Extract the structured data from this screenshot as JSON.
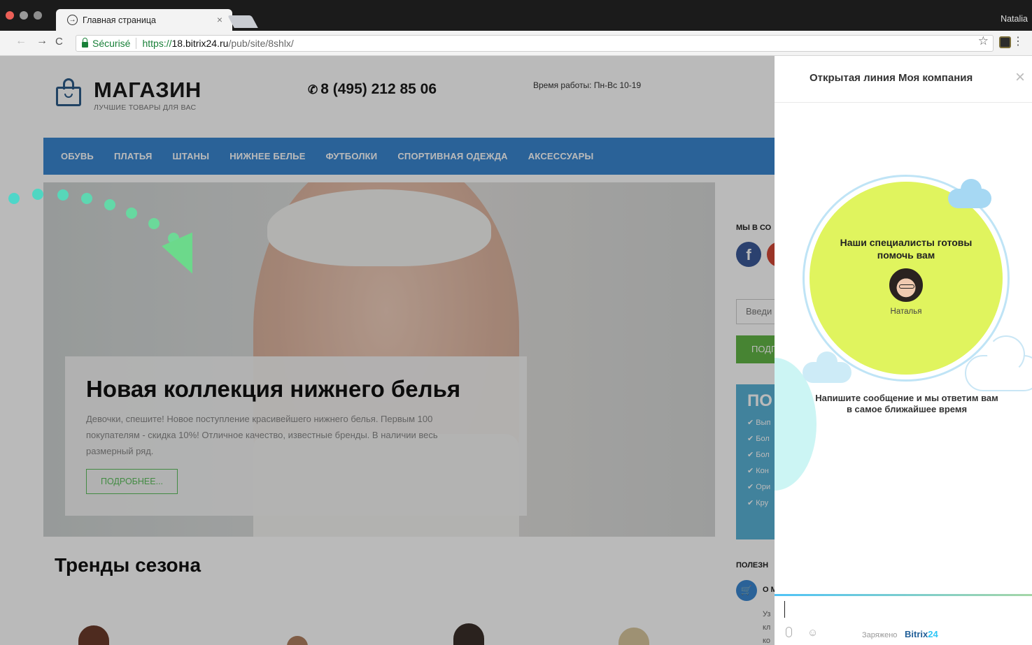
{
  "browser": {
    "tab_title": "Главная страница",
    "tab_favicon": "arrow-right-circle-icon",
    "tab_close": "×",
    "profile": "Natalia",
    "secure_label": "Sécurisé",
    "url_scheme": "https://",
    "url_host": "18.bitrix24.ru",
    "url_path": "/pub/site/8shlx/",
    "nav_back": "←",
    "nav_forward": "→",
    "nav_reload": "C",
    "star": "☆",
    "menu": "⋮"
  },
  "site": {
    "logo_title": "МАГАЗИН",
    "logo_subtitle": "ЛУЧШИЕ ТОВАРЫ ДЛЯ ВАС",
    "phone": "8 (495) 212 85 06",
    "hours": "Время работы: Пн-Вс 10-19",
    "nav": [
      "ОБУВЬ",
      "ПЛАТЬЯ",
      "ШТАНЫ",
      "НИЖНЕЕ БЕЛЬЕ",
      "ФУТБОЛКИ",
      "СПОРТИВНАЯ ОДЕЖДА",
      "АКСЕССУАРЫ"
    ],
    "hero": {
      "title": "Новая коллекция нижнего белья",
      "text": "Девочки, спешите! Новое поступление красивейшего нижнего белья. Первым 100 покупателям - скидка 10%! Отличное качество, известные бренды. В наличии весь размерный ряд.",
      "button": "ПОДРОБНЕЕ..."
    },
    "trends_title": "Тренды сезона",
    "sidebar": {
      "social_label": "МЫ В СО",
      "fb": "f",
      "input_placeholder": "Введи",
      "button": "ПОДП",
      "promo_title": "ПО",
      "promo_items": [
        "✔ Вып",
        "✔ Бол",
        "✔ Бол",
        "✔ Кон",
        "✔ Ори",
        "✔ Кру"
      ],
      "useful_label": "ПОЛЕЗН",
      "useful_item_title": "О М",
      "useful_text": [
        "Уз",
        "кл",
        "ко"
      ]
    }
  },
  "chat": {
    "title": "Открытая линия Моя компания",
    "close": "×",
    "operator_heading": "Наши специалисты готовы помочь вам",
    "operator_name": "Наталья",
    "hint": "Напишите сообщение и мы ответим вам в самое ближайшее время",
    "powered_by": "Заряжено",
    "brand_main": "Bitrix",
    "brand_num": "24",
    "colors": {
      "accent_ball": "#e0f45e",
      "brand_blue": "#2fc6f6"
    }
  }
}
